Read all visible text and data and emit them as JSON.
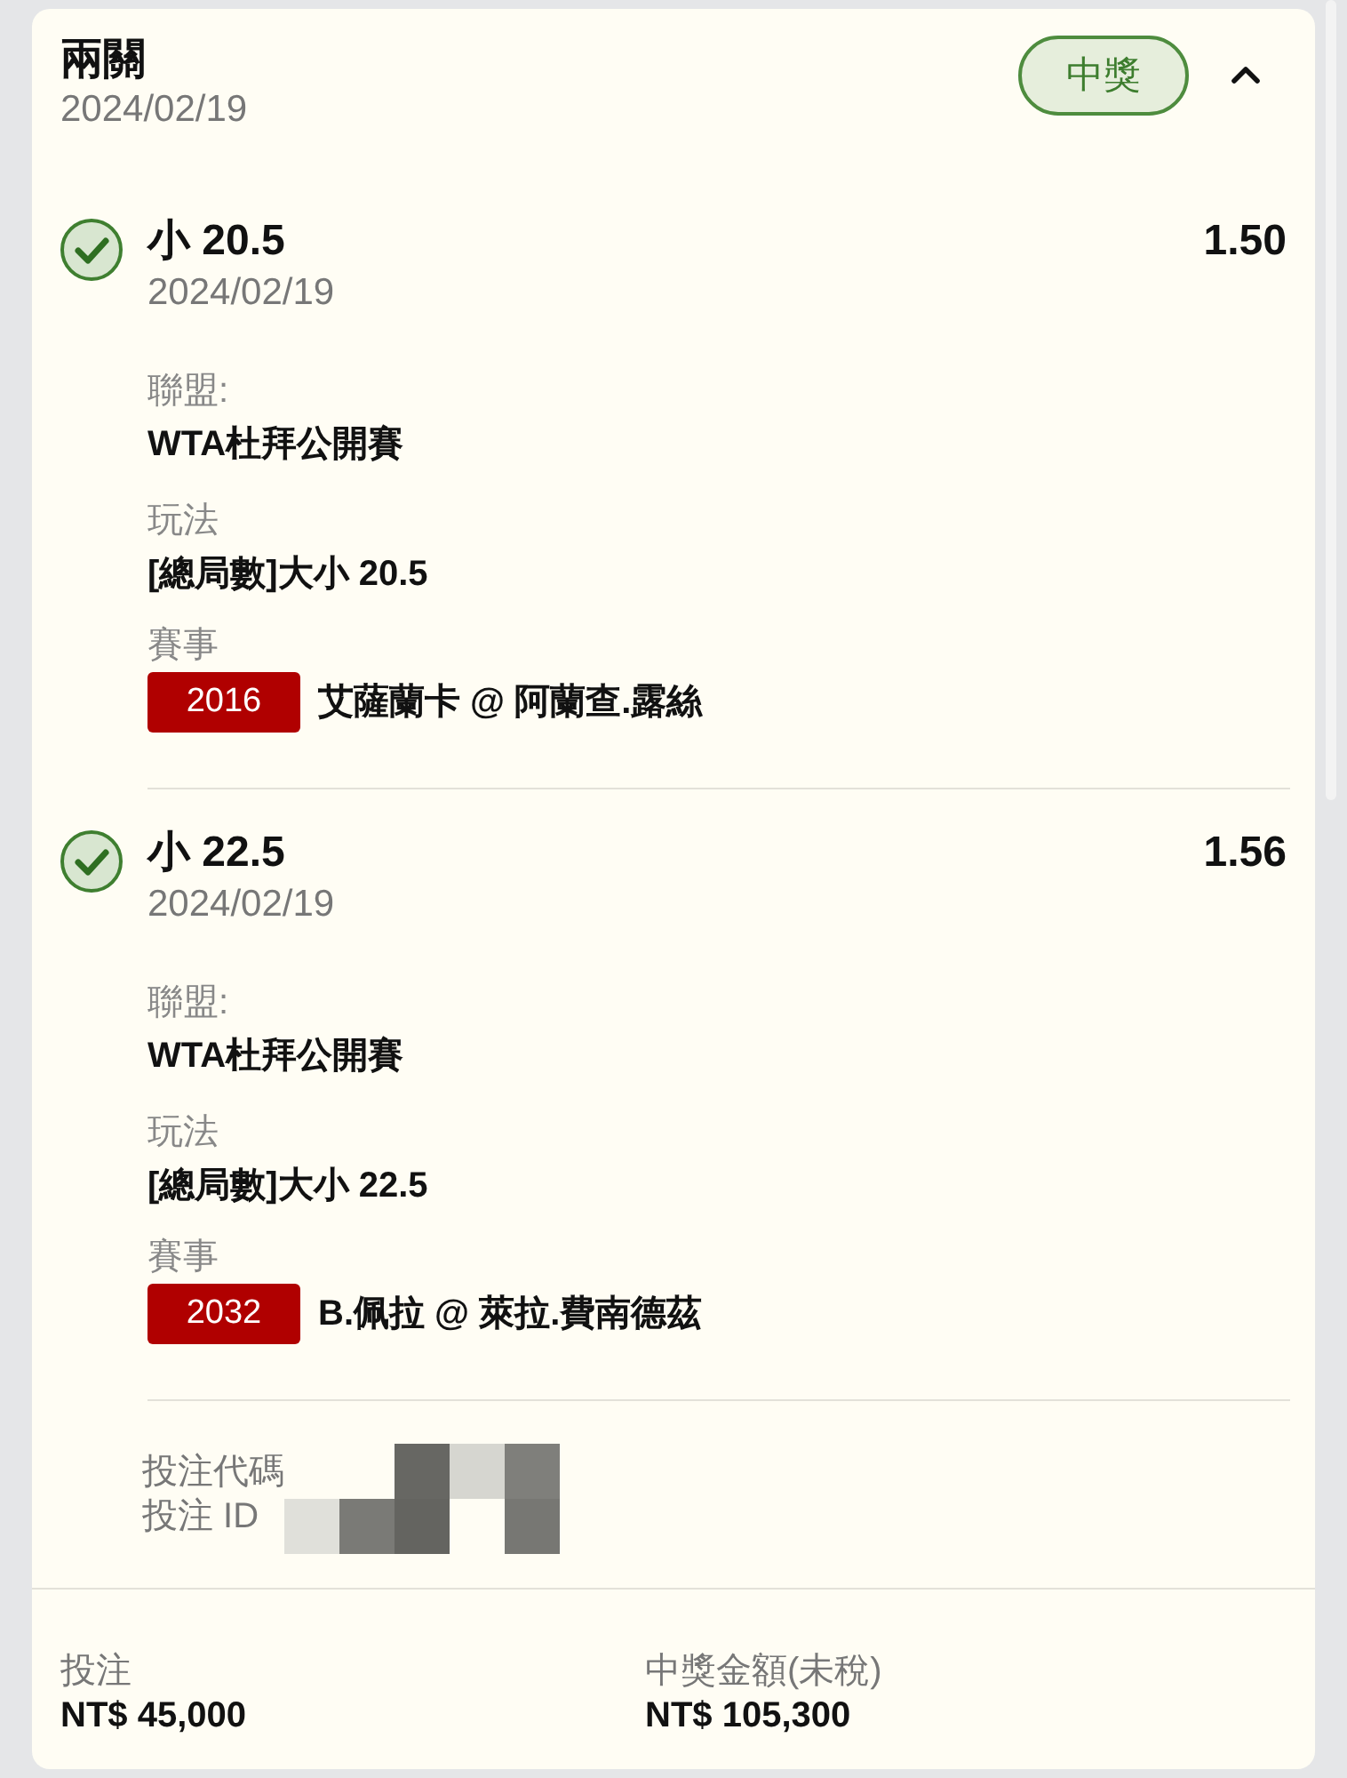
{
  "bet": {
    "title": "兩關",
    "date": "2024/02/19",
    "status": {
      "kind": "won",
      "label": "中獎"
    },
    "expanded": true
  },
  "legs": [
    {
      "won": true,
      "selection": "小 20.5",
      "odds": "1.50",
      "date": "2024/02/19",
      "fields": [
        {
          "label": "聯盟:",
          "value": "WTA杜拜公開賽"
        },
        {
          "label": "玩法",
          "value": "[總局數]大小 20.5"
        }
      ],
      "event": {
        "label": "賽事",
        "code": "2016",
        "match": "艾薩蘭卡 @ 阿蘭查.露絲"
      }
    },
    {
      "won": true,
      "selection": "小 22.5",
      "odds": "1.56",
      "date": "2024/02/19",
      "fields": [
        {
          "label": "聯盟:",
          "value": "WTA杜拜公開賽"
        },
        {
          "label": "玩法",
          "value": "[總局數]大小 22.5"
        }
      ],
      "event": {
        "label": "賽事",
        "code": "2032",
        "match": "B.佩拉 @ 萊拉.費南德茲"
      }
    }
  ],
  "ids": [
    {
      "label": "投注代碼"
    },
    {
      "label": "投注 ID"
    }
  ],
  "summary": [
    {
      "label": "投注",
      "value": "NT$ 45,000"
    },
    {
      "label": "中獎金額(未稅)",
      "value": "NT$ 105,300"
    }
  ]
}
